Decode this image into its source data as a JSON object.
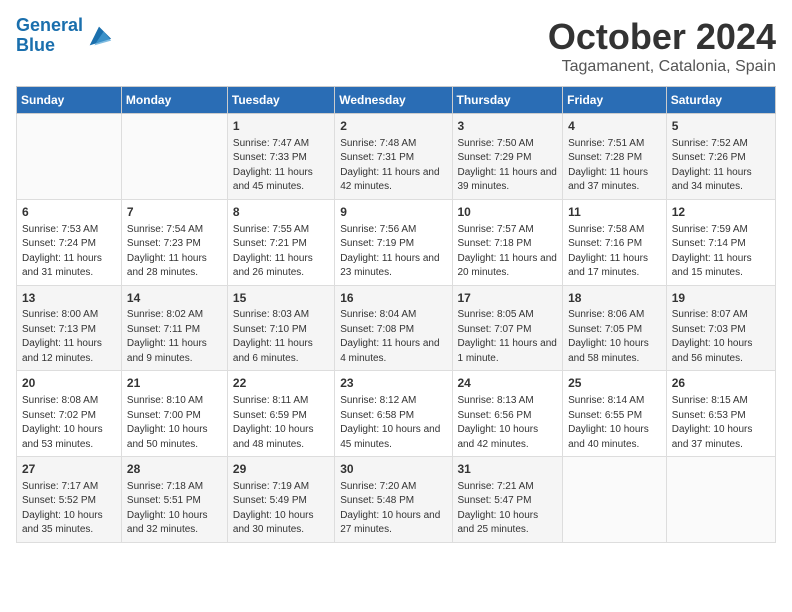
{
  "header": {
    "logo_general": "General",
    "logo_blue": "Blue",
    "month": "October 2024",
    "location": "Tagamanent, Catalonia, Spain"
  },
  "days_of_week": [
    "Sunday",
    "Monday",
    "Tuesday",
    "Wednesday",
    "Thursday",
    "Friday",
    "Saturday"
  ],
  "weeks": [
    [
      {
        "day": "",
        "info": ""
      },
      {
        "day": "",
        "info": ""
      },
      {
        "day": "1",
        "info": "Sunrise: 7:47 AM\nSunset: 7:33 PM\nDaylight: 11 hours and 45 minutes."
      },
      {
        "day": "2",
        "info": "Sunrise: 7:48 AM\nSunset: 7:31 PM\nDaylight: 11 hours and 42 minutes."
      },
      {
        "day": "3",
        "info": "Sunrise: 7:50 AM\nSunset: 7:29 PM\nDaylight: 11 hours and 39 minutes."
      },
      {
        "day": "4",
        "info": "Sunrise: 7:51 AM\nSunset: 7:28 PM\nDaylight: 11 hours and 37 minutes."
      },
      {
        "day": "5",
        "info": "Sunrise: 7:52 AM\nSunset: 7:26 PM\nDaylight: 11 hours and 34 minutes."
      }
    ],
    [
      {
        "day": "6",
        "info": "Sunrise: 7:53 AM\nSunset: 7:24 PM\nDaylight: 11 hours and 31 minutes."
      },
      {
        "day": "7",
        "info": "Sunrise: 7:54 AM\nSunset: 7:23 PM\nDaylight: 11 hours and 28 minutes."
      },
      {
        "day": "8",
        "info": "Sunrise: 7:55 AM\nSunset: 7:21 PM\nDaylight: 11 hours and 26 minutes."
      },
      {
        "day": "9",
        "info": "Sunrise: 7:56 AM\nSunset: 7:19 PM\nDaylight: 11 hours and 23 minutes."
      },
      {
        "day": "10",
        "info": "Sunrise: 7:57 AM\nSunset: 7:18 PM\nDaylight: 11 hours and 20 minutes."
      },
      {
        "day": "11",
        "info": "Sunrise: 7:58 AM\nSunset: 7:16 PM\nDaylight: 11 hours and 17 minutes."
      },
      {
        "day": "12",
        "info": "Sunrise: 7:59 AM\nSunset: 7:14 PM\nDaylight: 11 hours and 15 minutes."
      }
    ],
    [
      {
        "day": "13",
        "info": "Sunrise: 8:00 AM\nSunset: 7:13 PM\nDaylight: 11 hours and 12 minutes."
      },
      {
        "day": "14",
        "info": "Sunrise: 8:02 AM\nSunset: 7:11 PM\nDaylight: 11 hours and 9 minutes."
      },
      {
        "day": "15",
        "info": "Sunrise: 8:03 AM\nSunset: 7:10 PM\nDaylight: 11 hours and 6 minutes."
      },
      {
        "day": "16",
        "info": "Sunrise: 8:04 AM\nSunset: 7:08 PM\nDaylight: 11 hours and 4 minutes."
      },
      {
        "day": "17",
        "info": "Sunrise: 8:05 AM\nSunset: 7:07 PM\nDaylight: 11 hours and 1 minute."
      },
      {
        "day": "18",
        "info": "Sunrise: 8:06 AM\nSunset: 7:05 PM\nDaylight: 10 hours and 58 minutes."
      },
      {
        "day": "19",
        "info": "Sunrise: 8:07 AM\nSunset: 7:03 PM\nDaylight: 10 hours and 56 minutes."
      }
    ],
    [
      {
        "day": "20",
        "info": "Sunrise: 8:08 AM\nSunset: 7:02 PM\nDaylight: 10 hours and 53 minutes."
      },
      {
        "day": "21",
        "info": "Sunrise: 8:10 AM\nSunset: 7:00 PM\nDaylight: 10 hours and 50 minutes."
      },
      {
        "day": "22",
        "info": "Sunrise: 8:11 AM\nSunset: 6:59 PM\nDaylight: 10 hours and 48 minutes."
      },
      {
        "day": "23",
        "info": "Sunrise: 8:12 AM\nSunset: 6:58 PM\nDaylight: 10 hours and 45 minutes."
      },
      {
        "day": "24",
        "info": "Sunrise: 8:13 AM\nSunset: 6:56 PM\nDaylight: 10 hours and 42 minutes."
      },
      {
        "day": "25",
        "info": "Sunrise: 8:14 AM\nSunset: 6:55 PM\nDaylight: 10 hours and 40 minutes."
      },
      {
        "day": "26",
        "info": "Sunrise: 8:15 AM\nSunset: 6:53 PM\nDaylight: 10 hours and 37 minutes."
      }
    ],
    [
      {
        "day": "27",
        "info": "Sunrise: 7:17 AM\nSunset: 5:52 PM\nDaylight: 10 hours and 35 minutes."
      },
      {
        "day": "28",
        "info": "Sunrise: 7:18 AM\nSunset: 5:51 PM\nDaylight: 10 hours and 32 minutes."
      },
      {
        "day": "29",
        "info": "Sunrise: 7:19 AM\nSunset: 5:49 PM\nDaylight: 10 hours and 30 minutes."
      },
      {
        "day": "30",
        "info": "Sunrise: 7:20 AM\nSunset: 5:48 PM\nDaylight: 10 hours and 27 minutes."
      },
      {
        "day": "31",
        "info": "Sunrise: 7:21 AM\nSunset: 5:47 PM\nDaylight: 10 hours and 25 minutes."
      },
      {
        "day": "",
        "info": ""
      },
      {
        "day": "",
        "info": ""
      }
    ]
  ]
}
